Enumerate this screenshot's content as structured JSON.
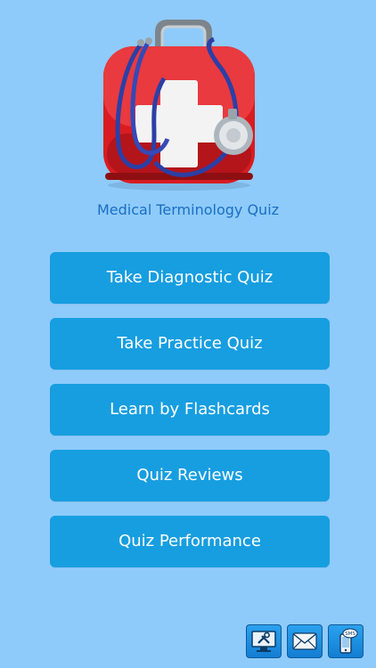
{
  "app": {
    "title": "Medical Terminology Quiz",
    "logo_icon": "first-aid-kit-stethoscope-icon"
  },
  "menu": [
    {
      "label": "Take Diagnostic Quiz"
    },
    {
      "label": "Take Practice Quiz"
    },
    {
      "label": "Learn by Flashcards"
    },
    {
      "label": "Quiz Reviews"
    },
    {
      "label": "Quiz Performance"
    }
  ],
  "toolbar": {
    "items": [
      {
        "icon": "tools-monitor-icon"
      },
      {
        "icon": "email-icon"
      },
      {
        "icon": "sms-phone-icon",
        "badge": "SMS"
      }
    ]
  },
  "colors": {
    "background": "#8ecbfb",
    "button": "#179ee0",
    "title_text": "#1a6fc2"
  }
}
